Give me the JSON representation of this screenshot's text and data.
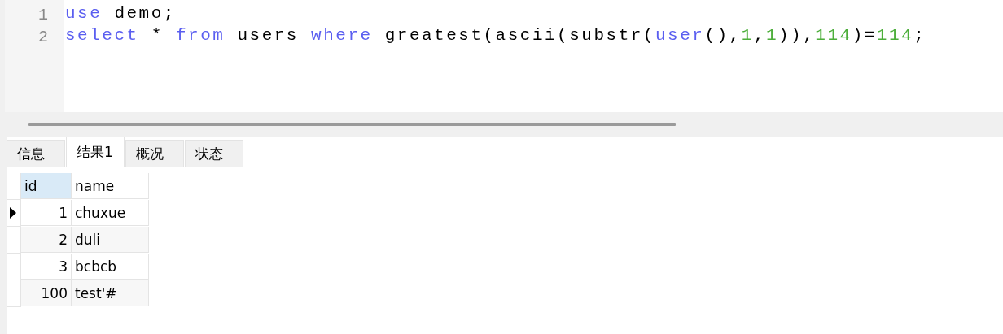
{
  "editor": {
    "lines": [
      {
        "number": "1",
        "tokens": [
          {
            "kind": "keyword",
            "text": "use"
          },
          {
            "kind": "plain",
            "text": " demo;"
          }
        ]
      },
      {
        "number": "2",
        "tokens": [
          {
            "kind": "keyword",
            "text": "select"
          },
          {
            "kind": "plain",
            "text": " * "
          },
          {
            "kind": "keyword",
            "text": "from"
          },
          {
            "kind": "plain",
            "text": " users "
          },
          {
            "kind": "keyword",
            "text": "where"
          },
          {
            "kind": "plain",
            "text": " greatest(ascii(substr("
          },
          {
            "kind": "keyword",
            "text": "user"
          },
          {
            "kind": "plain",
            "text": "(),"
          },
          {
            "kind": "number",
            "text": "1"
          },
          {
            "kind": "plain",
            "text": ","
          },
          {
            "kind": "number",
            "text": "1"
          },
          {
            "kind": "plain",
            "text": ")),"
          },
          {
            "kind": "number",
            "text": "114"
          },
          {
            "kind": "plain",
            "text": ")="
          },
          {
            "kind": "number",
            "text": "114"
          },
          {
            "kind": "plain",
            "text": ";"
          }
        ]
      }
    ]
  },
  "tabs": [
    {
      "label": "信息",
      "selected": false
    },
    {
      "label": "结果1",
      "selected": true
    },
    {
      "label": "概况",
      "selected": false
    },
    {
      "label": "状态",
      "selected": false
    }
  ],
  "table": {
    "columns": [
      {
        "label": "id",
        "selected": true
      },
      {
        "label": "name",
        "selected": false
      }
    ],
    "rows": [
      {
        "cells": [
          "1",
          "chuxue"
        ],
        "selected": true
      },
      {
        "cells": [
          "2",
          "duli"
        ],
        "selected": false
      },
      {
        "cells": [
          "3",
          "bcbcb"
        ],
        "selected": false
      },
      {
        "cells": [
          "100",
          "test'#"
        ],
        "selected": false
      }
    ]
  }
}
